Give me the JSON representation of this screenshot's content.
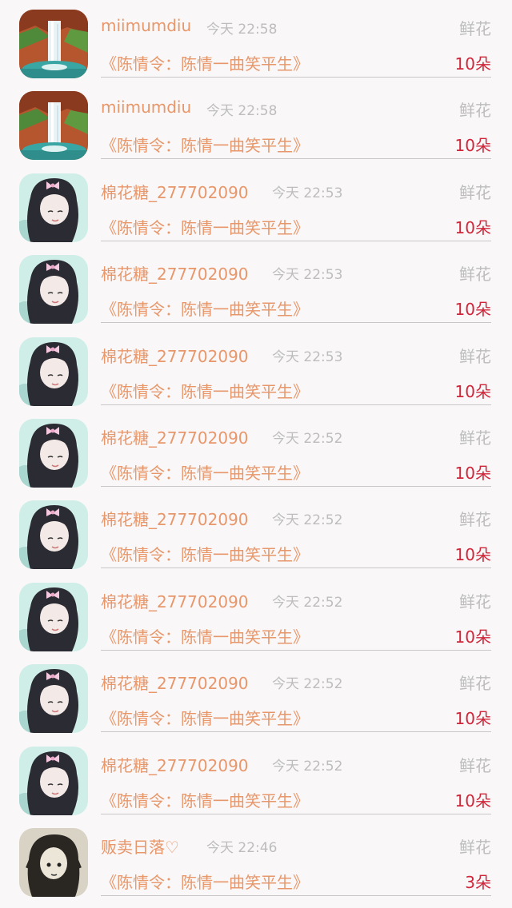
{
  "entries": [
    {
      "name": "miimumdiu",
      "time": "今天 22:58",
      "gift": "鲜花",
      "book": "《陈情令：陈情一曲笑平生》",
      "count": "10朵",
      "avatar": "waterfall"
    },
    {
      "name": "miimumdiu",
      "time": "今天 22:58",
      "gift": "鲜花",
      "book": "《陈情令：陈情一曲笑平生》",
      "count": "10朵",
      "avatar": "waterfall"
    },
    {
      "name": "棉花糖_277702090",
      "time": "今天 22:53",
      "gift": "鲜花",
      "book": "《陈情令：陈情一曲笑平生》",
      "count": "10朵",
      "avatar": "girl"
    },
    {
      "name": "棉花糖_277702090",
      "time": "今天 22:53",
      "gift": "鲜花",
      "book": "《陈情令：陈情一曲笑平生》",
      "count": "10朵",
      "avatar": "girl"
    },
    {
      "name": "棉花糖_277702090",
      "time": "今天 22:53",
      "gift": "鲜花",
      "book": "《陈情令：陈情一曲笑平生》",
      "count": "10朵",
      "avatar": "girl"
    },
    {
      "name": "棉花糖_277702090",
      "time": "今天 22:52",
      "gift": "鲜花",
      "book": "《陈情令：陈情一曲笑平生》",
      "count": "10朵",
      "avatar": "girl"
    },
    {
      "name": "棉花糖_277702090",
      "time": "今天 22:52",
      "gift": "鲜花",
      "book": "《陈情令：陈情一曲笑平生》",
      "count": "10朵",
      "avatar": "girl"
    },
    {
      "name": "棉花糖_277702090",
      "time": "今天 22:52",
      "gift": "鲜花",
      "book": "《陈情令：陈情一曲笑平生》",
      "count": "10朵",
      "avatar": "girl"
    },
    {
      "name": "棉花糖_277702090",
      "time": "今天 22:52",
      "gift": "鲜花",
      "book": "《陈情令：陈情一曲笑平生》",
      "count": "10朵",
      "avatar": "girl"
    },
    {
      "name": "棉花糖_277702090",
      "time": "今天 22:52",
      "gift": "鲜花",
      "book": "《陈情令：陈情一曲笑平生》",
      "count": "10朵",
      "avatar": "girl"
    },
    {
      "name": "贩卖日落♡",
      "time": "今天 22:46",
      "gift": "鲜花",
      "book": "《陈情令：陈情一曲笑平生》",
      "count": "3朵",
      "avatar": "sketch"
    }
  ],
  "colors": {
    "background": "#f9f7f8",
    "name": "#e8976b",
    "book": "#e8976b",
    "time": "#bdbdbd",
    "gift": "#bdbdbd",
    "count": "#d0263a",
    "divider": "#c8c8c8"
  }
}
